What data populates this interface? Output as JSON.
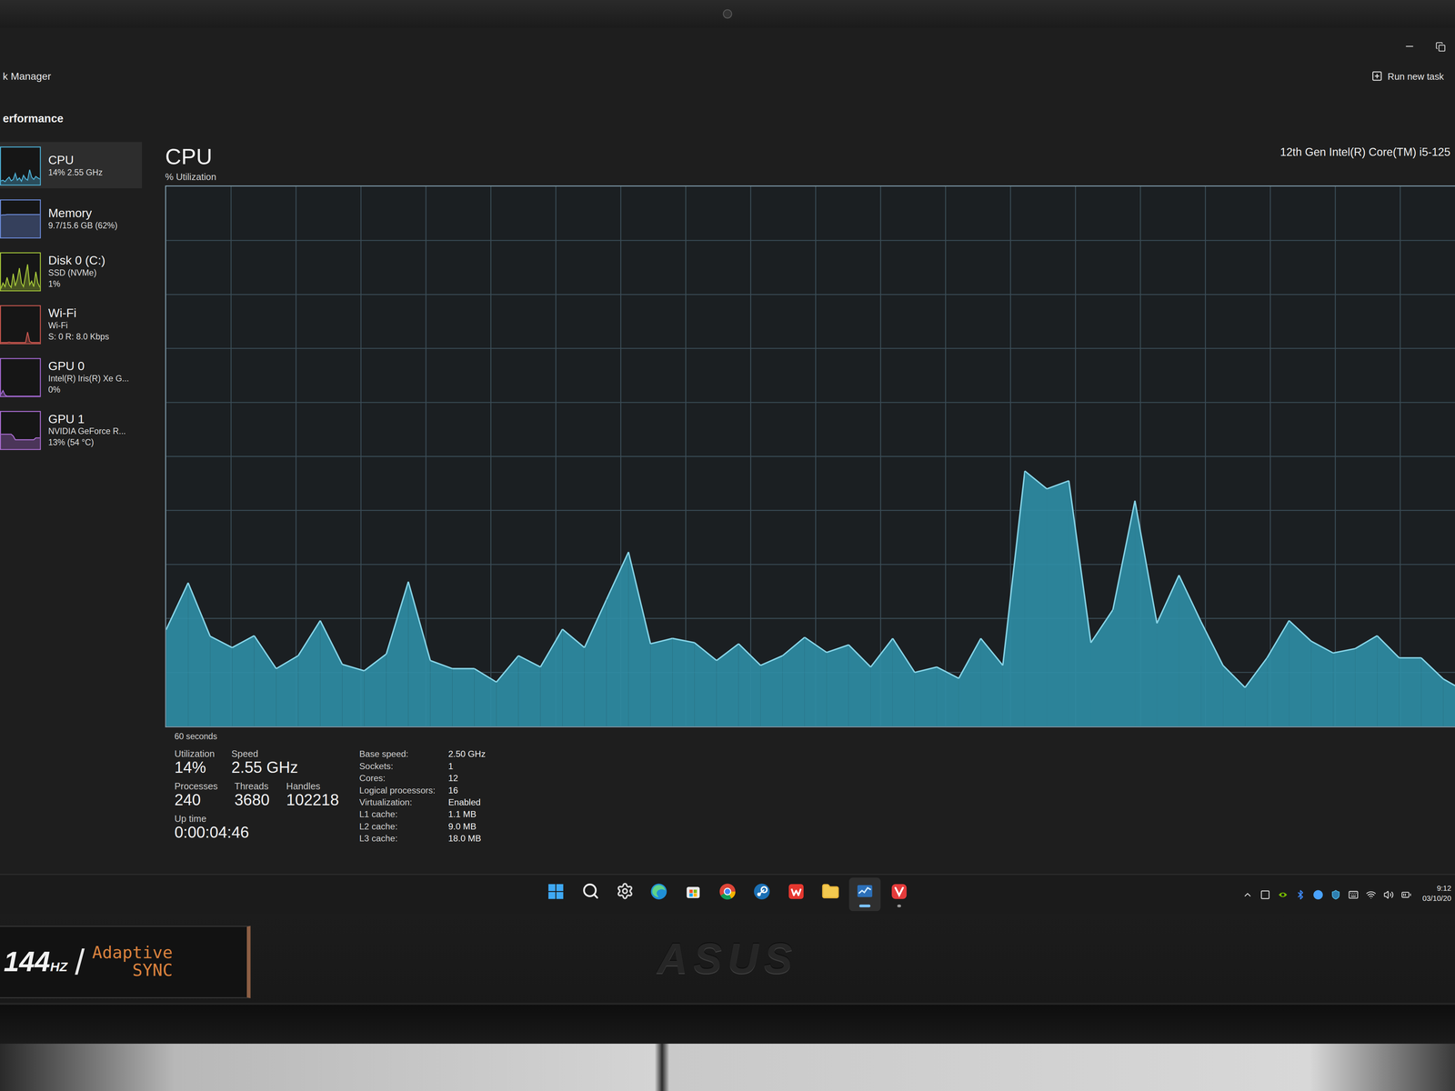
{
  "window": {
    "title": "k Manager"
  },
  "header": {
    "page": "erformance",
    "action": "Run new task"
  },
  "sidebar": {
    "items": [
      {
        "name": "CPU",
        "lines": [
          "14% 2.55 GHz"
        ],
        "selected": true,
        "color": "#4fb3d9",
        "graph": [
          10,
          12,
          8,
          15,
          20,
          10,
          14,
          30,
          12,
          18,
          9,
          25,
          16,
          12,
          40,
          20,
          14,
          22,
          18,
          15
        ]
      },
      {
        "name": "Memory",
        "lines": [
          "9.7/15.6 GB (62%)"
        ],
        "selected": false,
        "color": "#6f8fe0",
        "graph": [
          60,
          61,
          61,
          62,
          62,
          62,
          62,
          62,
          62,
          62,
          62,
          62,
          62,
          62,
          62,
          62,
          62,
          62,
          62,
          62
        ]
      },
      {
        "name": "Disk 0 (C:)",
        "lines": [
          "SSD (NVMe)",
          "1%"
        ],
        "selected": false,
        "color": "#a6c83a",
        "graph": [
          5,
          20,
          10,
          35,
          15,
          8,
          45,
          12,
          30,
          60,
          20,
          10,
          40,
          70,
          15,
          25,
          10,
          50,
          20,
          8
        ]
      },
      {
        "name": "Wi-Fi",
        "lines": [
          "Wi-Fi",
          "S: 0 R: 8.0 Kbps"
        ],
        "selected": false,
        "color": "#c9574f",
        "graph": [
          2,
          2,
          2,
          2,
          3,
          2,
          2,
          2,
          2,
          2,
          2,
          2,
          2,
          30,
          5,
          2,
          2,
          2,
          2,
          2
        ]
      },
      {
        "name": "GPU 0",
        "lines": [
          "Intel(R) Iris(R) Xe G...",
          "0%"
        ],
        "selected": false,
        "color": "#a66ad4",
        "graph": [
          5,
          15,
          3,
          0,
          0,
          0,
          0,
          0,
          0,
          0,
          0,
          0,
          0,
          0,
          0,
          0,
          0,
          0,
          0,
          0
        ]
      },
      {
        "name": "GPU 1",
        "lines": [
          "NVIDIA GeForce R...",
          "13% (54 °C)"
        ],
        "selected": false,
        "color": "#b070d8",
        "graph": [
          40,
          40,
          40,
          40,
          40,
          40,
          35,
          25,
          25,
          25,
          25,
          25,
          25,
          25,
          25,
          25,
          25,
          30,
          30,
          30
        ]
      }
    ]
  },
  "main": {
    "title": "CPU",
    "model": "12th Gen Intel(R) Core(TM) i5-125",
    "axis_label": "% Utilization",
    "time_label": "60 seconds",
    "axis_max": 100,
    "series": {
      "name": "% Utilization",
      "values": [
        17.9,
        26.6,
        16.7,
        14.6,
        16.8,
        10.7,
        13.1,
        19.6,
        11.5,
        10.3,
        13.4,
        26.8,
        12.2,
        10.7,
        10.7,
        8.2,
        13.1,
        11.0,
        18.0,
        14.6,
        23.5,
        32.3,
        15.3,
        16.3,
        15.5,
        12.2,
        15.3,
        11.3,
        13.1,
        16.5,
        13.7,
        15.1,
        11.0,
        16.3,
        10.0,
        11.0,
        8.9,
        16.3,
        11.3,
        47.3,
        44.0,
        45.5,
        15.5,
        21.6,
        41.8,
        19.1,
        28.0,
        19.4,
        11.3,
        7.2,
        12.7,
        19.6,
        15.8,
        13.6,
        14.4,
        16.8,
        12.7,
        12.7,
        8.8,
        6.5
      ]
    }
  },
  "stats": {
    "primary": [
      {
        "label": "Utilization",
        "value": "14%"
      },
      {
        "label": "Speed",
        "value": "2.55 GHz"
      }
    ],
    "secondary": [
      {
        "label": "Processes",
        "value": "240"
      },
      {
        "label": "Threads",
        "value": "3680"
      },
      {
        "label": "Handles",
        "value": "102218"
      }
    ],
    "uptime": {
      "label": "Up time",
      "value": "0:00:04:46"
    },
    "details": [
      {
        "label": "Base speed:",
        "value": "2.50 GHz"
      },
      {
        "label": "Sockets:",
        "value": "1"
      },
      {
        "label": "Cores:",
        "value": "12"
      },
      {
        "label": "Logical processors:",
        "value": "16"
      },
      {
        "label": "Virtualization:",
        "value": "Enabled"
      },
      {
        "label": "L1 cache:",
        "value": "1.1 MB"
      },
      {
        "label": "L2 cache:",
        "value": "9.0 MB"
      },
      {
        "label": "L3 cache:",
        "value": "18.0 MB"
      }
    ]
  },
  "taskbar": {
    "apps": [
      {
        "kind": "start",
        "selected": false,
        "running": false
      },
      {
        "kind": "search",
        "selected": false,
        "running": false
      },
      {
        "kind": "settings",
        "selected": false,
        "running": false
      },
      {
        "kind": "edge",
        "selected": false,
        "running": false
      },
      {
        "kind": "store",
        "selected": false,
        "running": false
      },
      {
        "kind": "chrome",
        "selected": false,
        "running": false
      },
      {
        "kind": "steam",
        "selected": false,
        "running": false
      },
      {
        "kind": "wps",
        "selected": false,
        "running": false
      },
      {
        "kind": "explorer",
        "selected": false,
        "running": false
      },
      {
        "kind": "taskmanager",
        "selected": true,
        "running": true
      },
      {
        "kind": "vivaldi",
        "selected": false,
        "running": true
      }
    ],
    "tray": {
      "icons": [
        {
          "kind": "chevron"
        },
        {
          "kind": "square"
        },
        {
          "kind": "nvidia"
        },
        {
          "kind": "bluetooth"
        },
        {
          "kind": "circle"
        },
        {
          "kind": "shield"
        },
        {
          "kind": "keyboard"
        },
        {
          "kind": "wifi"
        },
        {
          "kind": "volume"
        },
        {
          "kind": "battery"
        }
      ],
      "time": "9:12",
      "date": "03/10/20"
    }
  },
  "bezel": {
    "refresh": "144",
    "refresh_unit": "HZ",
    "separator": "/",
    "feature": [
      "Adaptive",
      "SYNC"
    ],
    "brand": "ASUS"
  }
}
